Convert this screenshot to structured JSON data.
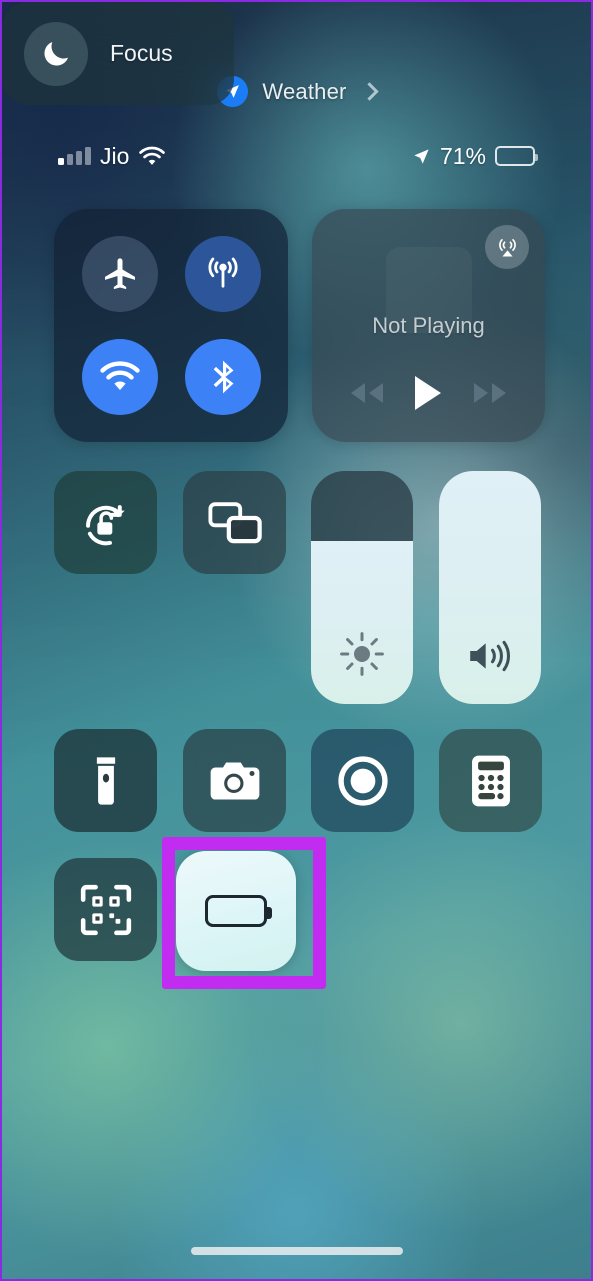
{
  "weather_pill": {
    "icon": "location-arrow-icon",
    "label": "Weather",
    "chevron": "chevron-right-icon",
    "badge_color": "#1b7df5"
  },
  "status_bar": {
    "signal_icon": "cellular-signal-bars-icon",
    "signal_bars_filled": 1,
    "signal_bars_total": 4,
    "carrier": "Jio",
    "wifi_icon": "wifi-icon",
    "location_icon": "location-arrow-icon",
    "battery_percent": "71%",
    "battery_fill_level": 71,
    "battery_color": "#fbd24b",
    "battery_icon": "battery-low-power-icon"
  },
  "connectivity": {
    "name": "connectivity-module",
    "toggles": [
      {
        "name": "airplane-mode",
        "icon": "airplane-icon",
        "state": "off"
      },
      {
        "name": "cellular-data",
        "icon": "cellular-antenna-icon",
        "state": "on"
      },
      {
        "name": "wifi",
        "icon": "wifi-icon",
        "state": "on"
      },
      {
        "name": "bluetooth",
        "icon": "bluetooth-icon",
        "state": "on"
      }
    ],
    "accent_on": "#3c82f6",
    "accent_mid": "#2c5699"
  },
  "media": {
    "name": "now-playing-module",
    "title": "Not Playing",
    "airplay_icon": "airplay-audio-icon",
    "controls": [
      {
        "name": "rewind-button",
        "icon": "rewind-icon"
      },
      {
        "name": "play-button",
        "icon": "play-icon"
      },
      {
        "name": "fast-forward-button",
        "icon": "fast-forward-icon"
      }
    ]
  },
  "toggles": {
    "rotation_lock": {
      "label": "Rotation Lock",
      "icon": "rotation-lock-open-icon",
      "state": "off"
    },
    "screen_mirroring": {
      "label": "Screen Mirroring",
      "icon": "screen-mirroring-icon",
      "state": "off"
    },
    "flashlight": {
      "label": "Flashlight",
      "icon": "flashlight-icon",
      "state": "off"
    },
    "camera": {
      "label": "Camera",
      "icon": "camera-icon",
      "state": "off"
    },
    "screen_recording": {
      "label": "Screen Recording",
      "icon": "record-circle-icon",
      "state": "off"
    },
    "calculator": {
      "label": "Calculator",
      "icon": "calculator-icon",
      "state": "off"
    },
    "qr_scanner": {
      "label": "Code Scanner",
      "icon": "qr-code-scanner-icon",
      "state": "off"
    },
    "low_power_mode": {
      "label": "Low Power Mode",
      "icon": "battery-icon",
      "state": "on",
      "battery_color": "#f5b820"
    }
  },
  "focus": {
    "label": "Focus",
    "icon": "moon-icon",
    "state": "off"
  },
  "sliders": {
    "brightness": {
      "label": "Brightness",
      "icon": "brightness-sun-icon",
      "value": 70
    },
    "volume": {
      "label": "Volume",
      "icon": "speaker-waves-icon",
      "value": 100
    }
  },
  "annotation": {
    "name": "highlight-box",
    "target": "low-power-mode-button",
    "color": "#c22cf0"
  },
  "home_indicator": {
    "name": "home-indicator"
  }
}
